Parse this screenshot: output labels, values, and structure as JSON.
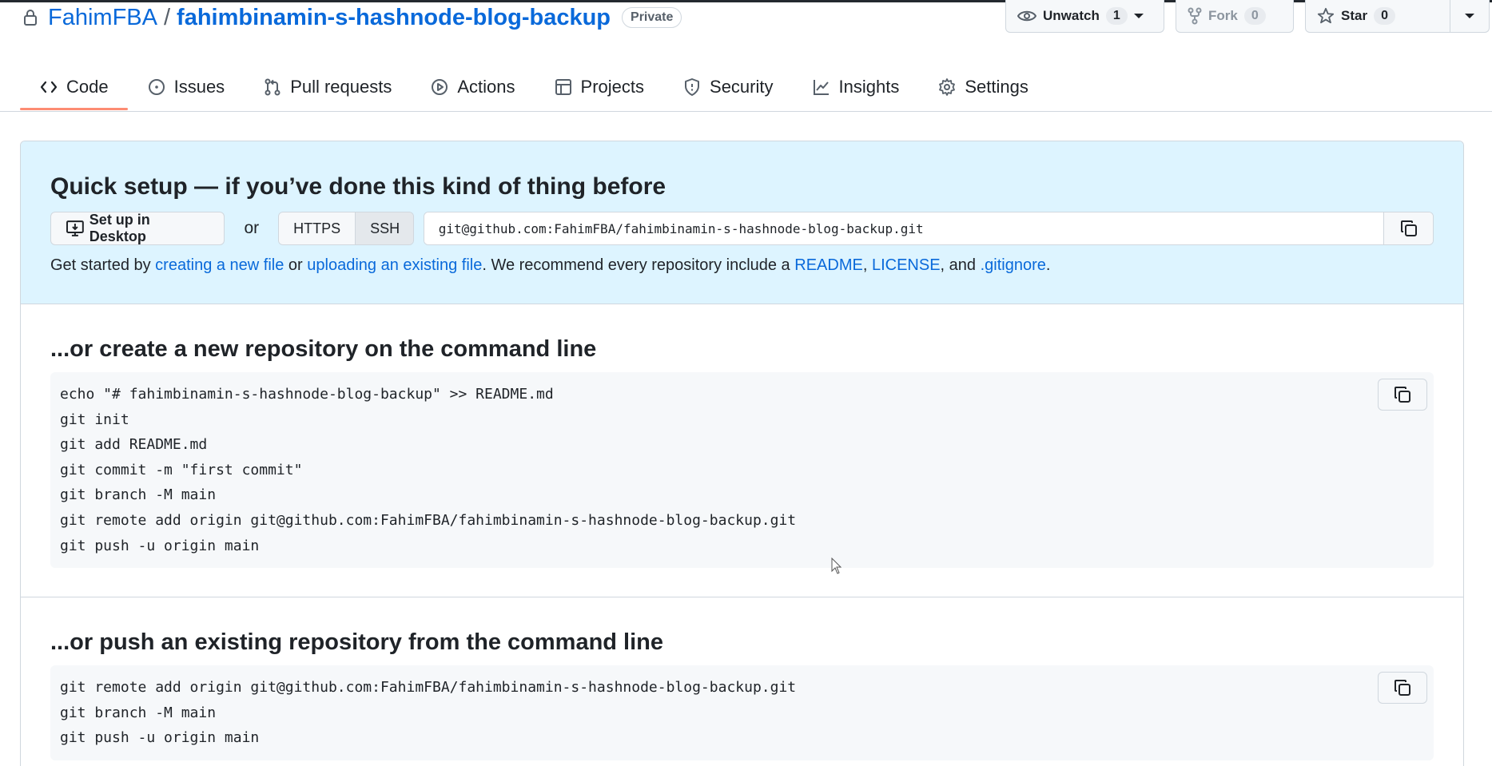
{
  "repo": {
    "owner": "FahimFBA",
    "separator": "/",
    "name": "fahimbinamin-s-hashnode-blog-backup",
    "visibility": "Private"
  },
  "actions": {
    "watch": {
      "label": "Unwatch",
      "count": "1"
    },
    "fork": {
      "label": "Fork",
      "count": "0"
    },
    "star": {
      "label": "Star",
      "count": "0"
    }
  },
  "nav": {
    "tabs": [
      {
        "label": "Code",
        "icon": "code-icon"
      },
      {
        "label": "Issues",
        "icon": "issue-icon"
      },
      {
        "label": "Pull requests",
        "icon": "pull-request-icon"
      },
      {
        "label": "Actions",
        "icon": "play-icon"
      },
      {
        "label": "Projects",
        "icon": "table-icon"
      },
      {
        "label": "Security",
        "icon": "shield-icon"
      },
      {
        "label": "Insights",
        "icon": "graph-icon"
      },
      {
        "label": "Settings",
        "icon": "gear-icon"
      }
    ]
  },
  "quick_setup": {
    "title": "Quick setup — if you’ve done this kind of thing before",
    "desktop_button": "Set up in Desktop",
    "or": "or",
    "https": "HTTPS",
    "ssh": "SSH",
    "url": "git@github.com:FahimFBA/fahimbinamin-s-hashnode-blog-backup.git",
    "intro": {
      "p1": "Get started by ",
      "link1": "creating a new file",
      "p2": " or ",
      "link2": "uploading an existing file",
      "p3": ". We recommend every repository include a ",
      "link3": "README",
      "p4": ", ",
      "link4": "LICENSE",
      "p5": ", and ",
      "link5": ".gitignore",
      "p6": "."
    }
  },
  "create_section": {
    "title": "...or create a new repository on the command line",
    "code": "echo \"# fahimbinamin-s-hashnode-blog-backup\" >> README.md\ngit init\ngit add README.md\ngit commit -m \"first commit\"\ngit branch -M main\ngit remote add origin git@github.com:FahimFBA/fahimbinamin-s-hashnode-blog-backup.git\ngit push -u origin main"
  },
  "push_section": {
    "title": "...or push an existing repository from the command line",
    "code": "git remote add origin git@github.com:FahimFBA/fahimbinamin-s-hashnode-blog-backup.git\ngit branch -M main\ngit push -u origin main"
  }
}
